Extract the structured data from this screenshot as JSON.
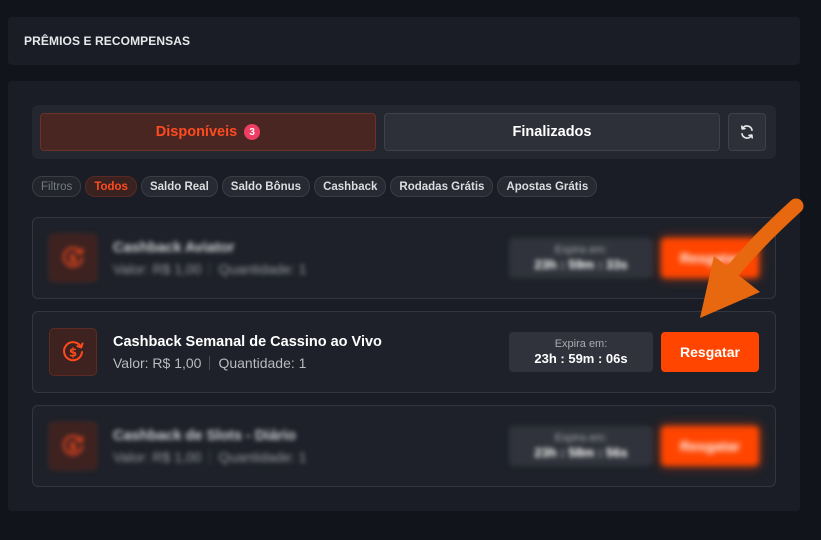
{
  "header": {
    "title": "PRÊMIOS E RECOMPENSAS"
  },
  "tabs": {
    "available_label": "Disponíveis",
    "available_count": "3",
    "finished_label": "Finalizados",
    "refresh_icon": "refresh-icon"
  },
  "filters": {
    "label": "Filtros",
    "items": [
      "Todos",
      "Saldo Real",
      "Saldo Bônus",
      "Cashback",
      "Rodadas Grátis",
      "Apostas Grátis"
    ],
    "active": "Todos"
  },
  "rewards": [
    {
      "title": "Cashback Aviator",
      "value": "Valor: R$ 1,00",
      "quantity": "Quantidade: 1",
      "expire_label": "Expira em:",
      "expire_time": "23h : 59m : 33s",
      "button": "Resgatar",
      "icon": "cashback-icon",
      "blurred": true
    },
    {
      "title": "Cashback Semanal de Cassino ao Vivo",
      "value": "Valor: R$ 1,00",
      "quantity": "Quantidade: 1",
      "expire_label": "Expira em:",
      "expire_time": "23h : 59m : 06s",
      "button": "Resgatar",
      "icon": "cashback-icon",
      "blurred": false
    },
    {
      "title": "Cashback de Slots - Diário",
      "value": "Valor: R$ 1,00",
      "quantity": "Quantidade: 1",
      "expire_label": "Expira em:",
      "expire_time": "23h : 58m : 56s",
      "button": "Resgatar",
      "icon": "cashback-icon",
      "blurred": true
    }
  ],
  "colors": {
    "accent": "#ff4500",
    "badge": "#ee3e63",
    "arrow": "#e8680f",
    "background": "#11141b",
    "panel": "#1a1d25"
  }
}
